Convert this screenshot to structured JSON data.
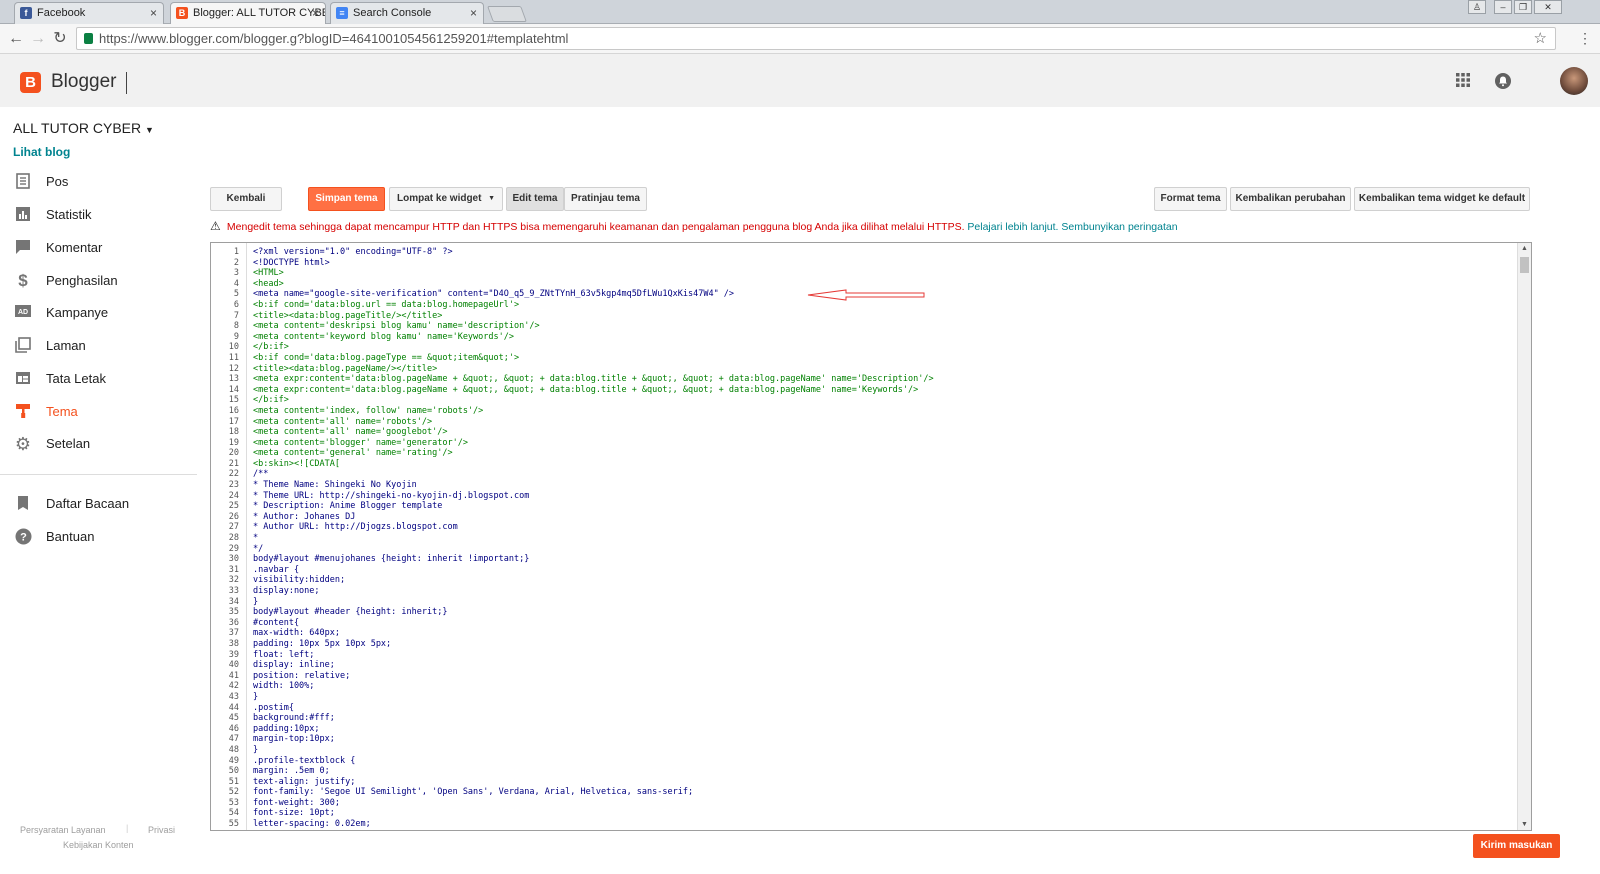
{
  "browser": {
    "tabs": [
      {
        "title": "Facebook",
        "icon": "facebook-icon",
        "color": "#3b5998"
      },
      {
        "title": "Blogger: ALL TUTOR CYBER",
        "icon": "blogger-icon",
        "color": "#f4511e"
      },
      {
        "title": "Search Console",
        "icon": "search-console-icon",
        "color": "#4285f4"
      }
    ],
    "url": "https://www.blogger.com/blogger.g?blogID=4641001054561259201#templatehtml"
  },
  "app": {
    "brand": "Blogger",
    "logo_letter": "B"
  },
  "sidebar": {
    "blog_name": "ALL TUTOR CYBER",
    "view_blog": "Lihat blog",
    "items": [
      {
        "label": "Pos",
        "icon": "posts-icon"
      },
      {
        "label": "Statistik",
        "icon": "stats-icon"
      },
      {
        "label": "Komentar",
        "icon": "comments-icon"
      },
      {
        "label": "Penghasilan",
        "icon": "earnings-icon"
      },
      {
        "label": "Kampanye",
        "icon": "campaigns-icon"
      },
      {
        "label": "Laman",
        "icon": "pages-icon"
      },
      {
        "label": "Tata Letak",
        "icon": "layout-icon"
      },
      {
        "label": "Tema",
        "icon": "theme-icon",
        "active": true
      },
      {
        "label": "Setelan",
        "icon": "settings-icon"
      }
    ],
    "items2": [
      {
        "label": "Daftar Bacaan",
        "icon": "reading-list-icon"
      },
      {
        "label": "Bantuan",
        "icon": "help-icon"
      }
    ],
    "footer": {
      "terms": "Persyaratan Layanan",
      "privacy": "Privasi",
      "content_policy": "Kebijakan Konten"
    }
  },
  "toolbar": {
    "back": "Kembali",
    "save": "Simpan tema",
    "jump": "Lompat ke widget",
    "edit": "Edit tema",
    "preview": "Pratinjau tema",
    "format": "Format tema",
    "revert": "Kembalikan perubahan",
    "revert_widgets": "Kembalikan tema widget ke default"
  },
  "warning": {
    "text": "Mengedit tema sehingga dapat mencampur HTTP dan HTTPS bisa memengaruhi keamanan dan pengalaman pengguna blog Anda jika dilihat melalui HTTPS.",
    "learn_more": "Pelajari lebih lanjut.",
    "hide": "Sembunyikan peringatan"
  },
  "editor": {
    "lines": [
      {
        "n": "1",
        "t": "<?xml version=\"1.0\" encoding=\"UTF-8\" ?>",
        "c": "plain"
      },
      {
        "n": "2",
        "t": "<!DOCTYPE html>",
        "c": "plain"
      },
      {
        "n": "3",
        "t": "<HTML>",
        "c": "tag"
      },
      {
        "n": "4",
        "t": "<head>",
        "c": "tag"
      },
      {
        "n": "5",
        "t": "<meta name=\"google-site-verification\" content=\"D4O_q5_9_ZNtTYnH_63v5kgp4mq5DfLWu1QxKis47W4\" />",
        "c": "plain"
      },
      {
        "n": "6",
        "t": "<b:if cond='data:blog.url == data:blog.homepageUrl'>",
        "c": "tag"
      },
      {
        "n": "7",
        "t": "<title><data:blog.pageTitle/></title>",
        "c": "tag"
      },
      {
        "n": "8",
        "t": "<meta content='deskripsi blog kamu' name='description'/>",
        "c": "tag"
      },
      {
        "n": "9",
        "t": "<meta content='keyword blog kamu' name='Keywords'/>",
        "c": "tag"
      },
      {
        "n": "10",
        "t": "</b:if>",
        "c": "tag"
      },
      {
        "n": "11",
        "t": "<b:if cond='data:blog.pageType == &quot;item&quot;'>",
        "c": "tag"
      },
      {
        "n": "12",
        "t": "<title><data:blog.pageName/></title>",
        "c": "tag"
      },
      {
        "n": "13",
        "t": "<meta expr:content='data:blog.pageName + &quot;, &quot; + data:blog.title + &quot;, &quot; + data:blog.pageName' name='Description'/>",
        "c": "tag"
      },
      {
        "n": "14",
        "t": "<meta expr:content='data:blog.pageName + &quot;, &quot; + data:blog.title + &quot;, &quot; + data:blog.pageName' name='Keywords'/>",
        "c": "tag"
      },
      {
        "n": "15",
        "t": "</b:if>",
        "c": "tag"
      },
      {
        "n": "16",
        "t": "<meta content='index, follow' name='robots'/>",
        "c": "tag"
      },
      {
        "n": "17",
        "t": "<meta content='all' name='robots'/>",
        "c": "tag"
      },
      {
        "n": "18",
        "t": "<meta content='all' name='googlebot'/>",
        "c": "tag"
      },
      {
        "n": "19",
        "t": "<meta content='blogger' name='generator'/>",
        "c": "tag"
      },
      {
        "n": "20",
        "t": "<meta content='general' name='rating'/>",
        "c": "tag"
      },
      {
        "n": "21",
        "t": "<b:skin><![CDATA[",
        "c": "tag"
      },
      {
        "n": "22",
        "t": "/**",
        "c": "plain"
      },
      {
        "n": "23",
        "t": "* Theme Name: Shingeki No Kyojin",
        "c": "plain"
      },
      {
        "n": "24",
        "t": "* Theme URL: http://shingeki-no-kyojin-dj.blogspot.com",
        "c": "plain"
      },
      {
        "n": "25",
        "t": "* Description: Anime Blogger template",
        "c": "plain"
      },
      {
        "n": "26",
        "t": "* Author: Johanes DJ",
        "c": "plain"
      },
      {
        "n": "27",
        "t": "* Author URL: http://Djogzs.blogspot.com",
        "c": "plain"
      },
      {
        "n": "28",
        "t": "*",
        "c": "plain"
      },
      {
        "n": "29",
        "t": "*/",
        "c": "plain"
      },
      {
        "n": "30",
        "t": "body#layout #menujohanes {height: inherit !important;}",
        "c": "plain"
      },
      {
        "n": "31",
        "t": ".navbar {",
        "c": "plain"
      },
      {
        "n": "32",
        "t": "visibility:hidden;",
        "c": "plain"
      },
      {
        "n": "33",
        "t": "display:none;",
        "c": "plain"
      },
      {
        "n": "34",
        "t": "}",
        "c": "plain"
      },
      {
        "n": "35",
        "t": "body#layout #header {height: inherit;}",
        "c": "plain"
      },
      {
        "n": "36",
        "t": "#content{",
        "c": "plain"
      },
      {
        "n": "37",
        "t": "max-width: 640px;",
        "c": "plain"
      },
      {
        "n": "38",
        "t": "padding: 10px 5px 10px 5px;",
        "c": "plain"
      },
      {
        "n": "39",
        "t": "float: left;",
        "c": "plain"
      },
      {
        "n": "40",
        "t": "display: inline;",
        "c": "plain"
      },
      {
        "n": "41",
        "t": "position: relative;",
        "c": "plain"
      },
      {
        "n": "42",
        "t": "width: 100%;",
        "c": "plain"
      },
      {
        "n": "43",
        "t": "}",
        "c": "plain"
      },
      {
        "n": "44",
        "t": ".postim{",
        "c": "plain"
      },
      {
        "n": "45",
        "t": "background:#fff;",
        "c": "plain"
      },
      {
        "n": "46",
        "t": "padding:10px;",
        "c": "plain"
      },
      {
        "n": "47",
        "t": "margin-top:10px;",
        "c": "plain"
      },
      {
        "n": "48",
        "t": "}",
        "c": "plain"
      },
      {
        "n": "49",
        "t": ".profile-textblock {",
        "c": "plain"
      },
      {
        "n": "50",
        "t": "margin: .5em 0;",
        "c": "plain"
      },
      {
        "n": "51",
        "t": "text-align: justify;",
        "c": "plain"
      },
      {
        "n": "52",
        "t": "font-family: 'Segoe UI Semilight', 'Open Sans', Verdana, Arial, Helvetica, sans-serif;",
        "c": "plain"
      },
      {
        "n": "53",
        "t": "font-weight: 300;",
        "c": "plain"
      },
      {
        "n": "54",
        "t": "font-size: 10pt;",
        "c": "plain"
      },
      {
        "n": "55",
        "t": "letter-spacing: 0.02em;",
        "c": "plain"
      }
    ]
  },
  "feedback": "Kirim masukan",
  "colors": {
    "accent": "#f4511e",
    "link": "#00838f",
    "warning": "#d50000"
  }
}
